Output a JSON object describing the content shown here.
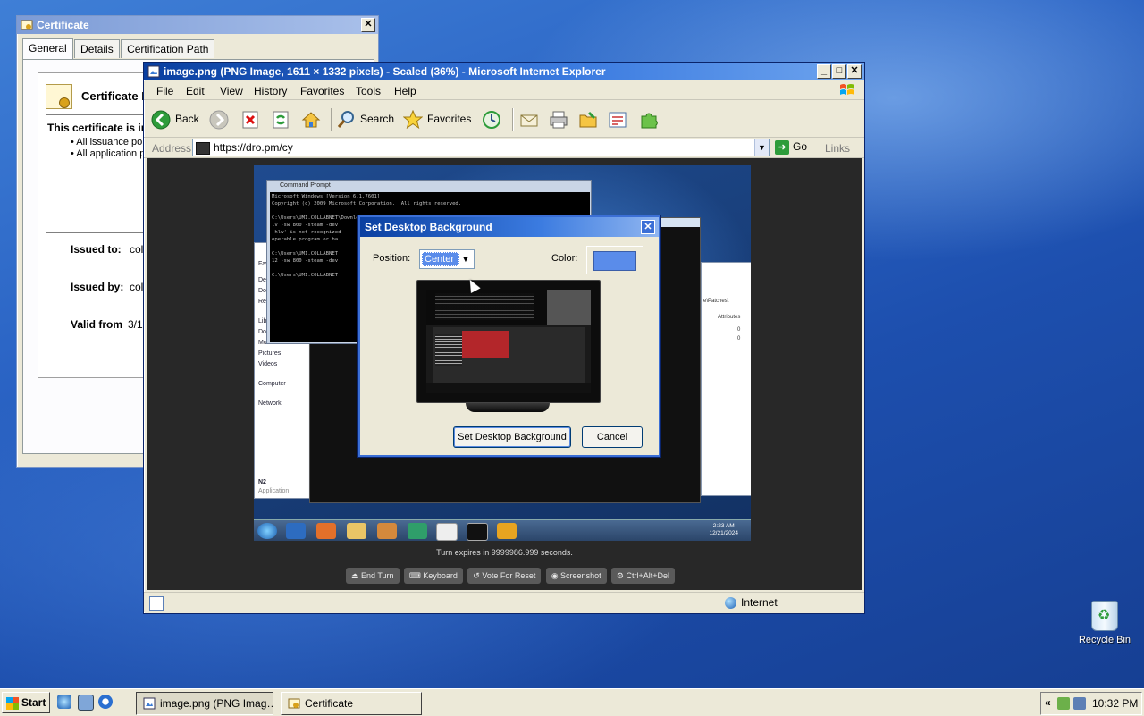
{
  "desktop": {
    "recycle_bin_label": "Recycle Bin"
  },
  "certificate": {
    "title": "Certificate",
    "close": "✕",
    "tabs": [
      "General",
      "Details",
      "Certification Path"
    ],
    "heading": "Certificate I",
    "purpose": "This certificate is in",
    "bullets": [
      "• All issuance pol",
      "• All application p"
    ],
    "issued_to_label": "Issued to:",
    "issued_to_value": "col",
    "issued_by_label": "Issued by:",
    "issued_by_value": "col",
    "valid_from_label": "Valid from",
    "valid_from_value": "3/1"
  },
  "ie": {
    "title": "image.png (PNG Image, 1611 × 1332 pixels) - Scaled (36%) - Microsoft Internet Explorer",
    "controls": {
      "minimize": "_",
      "maximize": "□",
      "close": "✕"
    },
    "menu": [
      "File",
      "Edit",
      "View",
      "History",
      "Favorites",
      "Tools",
      "Help"
    ],
    "toolbar": {
      "back": "Back",
      "search": "Search",
      "favorites": "Favorites"
    },
    "address_label": "Address",
    "address_value": "https://dro.pm/cy",
    "go_label": "Go",
    "links_label": "Links",
    "links_chevron": "»",
    "status_zone": "Internet"
  },
  "remote": {
    "cmd_title": "Command Prompt",
    "cmd_lines": [
      "Microsoft Windows [Version 6.1.7601]",
      "Copyright (c) 2009 Microsoft Corporation.  All rights reserved.",
      "",
      "C:\\Users\\UM1.COLLABNET\\Downloads\\aria2-1.37.0-win-64bit-build1\\hl2\\Half-Life 2>",
      "lv -sw 800 -steam -dev",
      "'hlw' is not recognized",
      "operable program or ba",
      "",
      "C:\\Users\\UM1.COLLABNET",
      "12 -sw 800 -steam -dev",
      "",
      "C:\\Users\\UM1.COLLABNET"
    ],
    "sidebar": [
      "Favo",
      "De",
      "Do",
      "Re",
      "Libra",
      "Do",
      "Mu",
      "Pictures",
      "Videos",
      "Computer",
      "Network",
      "N2",
      "Application"
    ],
    "right_pane": [
      "e\\Patches\\",
      "Attributes",
      "0",
      "0"
    ],
    "clock_time": "2:23 AM",
    "clock_date": "12/21/2024",
    "turn_info": "Turn expires in 9999986.999 seconds.",
    "controls": [
      "End Turn",
      "Keyboard",
      "Vote For Reset",
      "Screenshot",
      "Ctrl+Alt+Del"
    ]
  },
  "dialog": {
    "title": "Set Desktop Background",
    "close": "✕",
    "position_label": "Position:",
    "position_value": "Center",
    "position_arrow": "▼",
    "color_label": "Color:",
    "swatch_color": "#5a8cea",
    "set_button": "Set Desktop Background",
    "cancel_button": "Cancel"
  },
  "taskbar": {
    "start_label": "Start",
    "tasks": [
      {
        "label": "image.png (PNG Imag…",
        "active": true
      },
      {
        "label": "Certificate",
        "active": false
      }
    ],
    "tray_chevron": "«",
    "clock": "10:32 PM"
  },
  "colors": {
    "titlebar_active": "#0a3fa0",
    "titlebar_inactive": "#7c9bd6",
    "window_face": "#ece9d8"
  }
}
